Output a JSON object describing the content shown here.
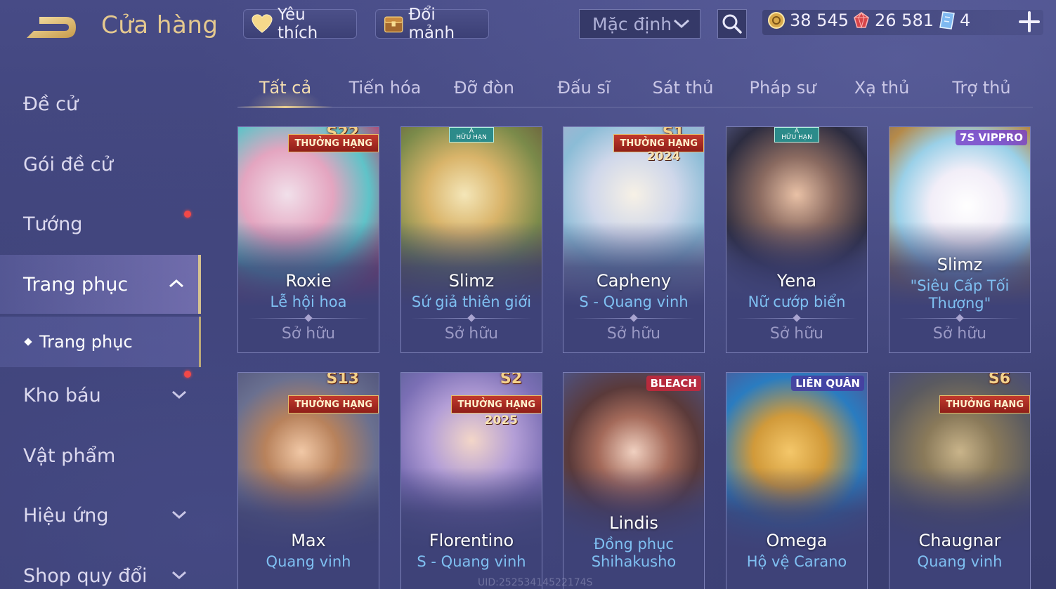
{
  "header": {
    "title": "Cửa hàng",
    "favorites_label": "Yêu thích",
    "fragments_label": "Đổi mảnh",
    "sort_value": "Mặc định",
    "currencies": [
      {
        "name": "gold-coin",
        "value": "38 545"
      },
      {
        "name": "ruby",
        "value": "26 581"
      },
      {
        "name": "voucher",
        "value": "4"
      }
    ]
  },
  "sidebar": {
    "items": [
      {
        "label": "Đề cử"
      },
      {
        "label": "Gói đề cử"
      },
      {
        "label": "Tướng"
      },
      {
        "label": "Trang phục"
      },
      {
        "label": "Trang phục"
      },
      {
        "label": "Kho báu"
      },
      {
        "label": "Vật phẩm"
      },
      {
        "label": "Hiệu ứng"
      },
      {
        "label": "Shop quy đổi"
      }
    ]
  },
  "tabs": [
    "Tất cả",
    "Tiến hóa",
    "Đỡ đòn",
    "Đấu sĩ",
    "Sát thủ",
    "Pháp sư",
    "Xạ thủ",
    "Trợ thủ"
  ],
  "cards": [
    {
      "hero": "Roxie",
      "skin": "Lễ hội hoa",
      "status": "Sở hữu",
      "badge": "THƯỞNG HẠNG",
      "badge_top": "S22",
      "badge_year": ""
    },
    {
      "hero": "Slimz",
      "skin": "Sứ giả thiên giới",
      "status": "Sở hữu",
      "limited": "A",
      "limited_sub": "HỮU HẠN"
    },
    {
      "hero": "Capheny",
      "skin": "S - Quang vinh",
      "status": "Sở hữu",
      "badge": "THƯỞNG HẠNG",
      "badge_top": "S1",
      "badge_year": "2024"
    },
    {
      "hero": "Yena",
      "skin": "Nữ cướp biển",
      "status": "Sở hữu",
      "limited": "A",
      "limited_sub": "HỮU HẠN"
    },
    {
      "hero": "Slimz",
      "skin": "\"Siêu Cấp Tối Thượng\"",
      "status": "Sở hữu",
      "tag": "7S VIPPRO"
    },
    {
      "hero": "Max",
      "skin": "Quang vinh",
      "status": "Sở hữu",
      "badge": "THƯỞNG HẠNG",
      "badge_top": "S13",
      "badge_year": ""
    },
    {
      "hero": "Florentino",
      "skin": "S - Quang vinh",
      "status": "Sở hữu",
      "badge": "THƯỞNG HẠNG",
      "badge_top": "S2",
      "badge_year": "2025"
    },
    {
      "hero": "Lindis",
      "skin": "Đồng phục Shihakusho",
      "status": "Sở hữu",
      "tag": "BLEACH"
    },
    {
      "hero": "Omega",
      "skin": "Hộ vệ Carano",
      "status": "Sở hữu",
      "tag": "LIÊN QUÂN"
    },
    {
      "hero": "Chaugnar",
      "skin": "Quang vinh",
      "status": "Sở hữu",
      "badge": "THƯỞNG HẠNG",
      "badge_top": "S6",
      "badge_year": ""
    }
  ],
  "watermark": "UID:25253414522174S",
  "colors": {
    "accent_gold": "#e5c98f",
    "skin_name_blue": "#7fc0f2",
    "notification_red": "#f24848"
  }
}
